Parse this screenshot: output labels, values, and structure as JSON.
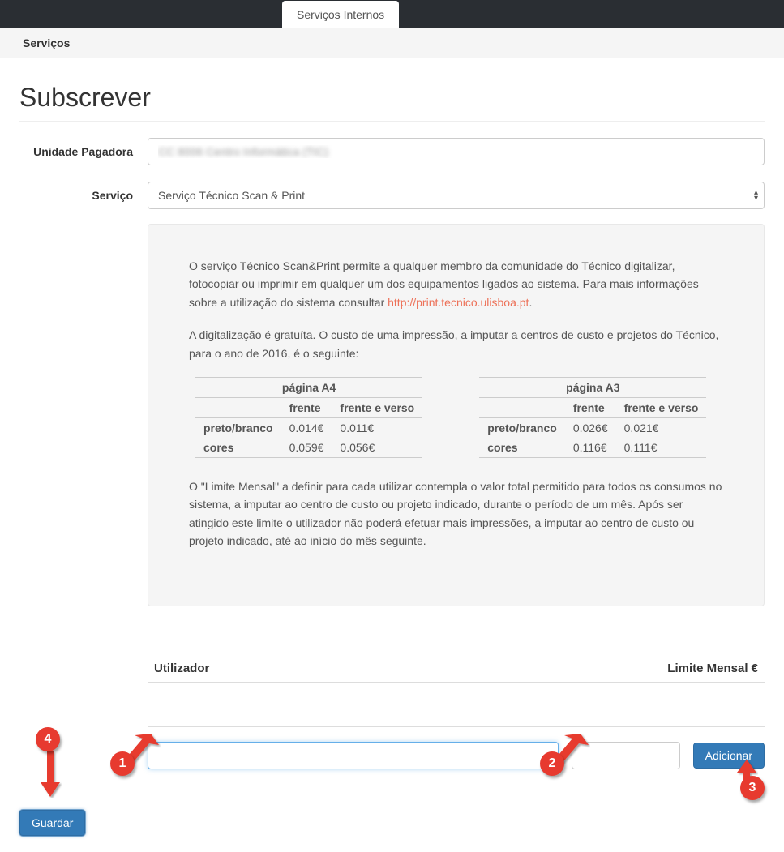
{
  "topTab": "Serviços Internos",
  "subNav": "Serviços",
  "pageTitle": "Subscrever",
  "labels": {
    "unidadePagadora": "Unidade Pagadora",
    "servico": "Serviço",
    "utilizador": "Utilizador",
    "limiteMensal": "Limite Mensal €"
  },
  "unidadeValue": "CC 8006 Centro Informática (TIC)",
  "servicoValue": "Serviço Técnico Scan & Print",
  "info": {
    "p1a": "O serviço Técnico Scan&Print permite a qualquer membro da comunidade do Técnico digitalizar, fotocopiar ou imprimir em qualquer um dos equipamentos ligados ao sistema. Para mais informações sobre a utilização do sistema consultar ",
    "link": "http://print.tecnico.ulisboa.pt",
    "p1b": ".",
    "p2": "A digitalização é gratuíta. O custo de uma impressão, a imputar a centros de custo e projetos do Técnico, para o ano de 2016, é o seguinte:",
    "p3": "O \"Limite Mensal\" a definir para cada utilizar contempla o valor total permitido para todos os consumos no sistema, a imputar ao centro de custo ou projeto indicado, durante o período de um mês. Após ser atingido este limite o utilizador não poderá efetuar mais impressões, a imputar ao centro de custo ou projeto indicado, até ao início do mês seguinte."
  },
  "priceTables": {
    "headers": {
      "frente": "frente",
      "frenteVerso": "frente e verso"
    },
    "rows": {
      "pb": "preto/branco",
      "cores": "cores"
    },
    "a4": {
      "title": "página A4",
      "pb": {
        "frente": "0.014€",
        "verso": "0.011€"
      },
      "cores": {
        "frente": "0.059€",
        "verso": "0.056€"
      }
    },
    "a3": {
      "title": "página A3",
      "pb": {
        "frente": "0.026€",
        "verso": "0.021€"
      },
      "cores": {
        "frente": "0.116€",
        "verso": "0.111€"
      }
    }
  },
  "buttons": {
    "adicionar": "Adicionar",
    "guardar": "Guardar"
  },
  "markers": {
    "m1": "1",
    "m2": "2",
    "m3": "3",
    "m4": "4"
  }
}
